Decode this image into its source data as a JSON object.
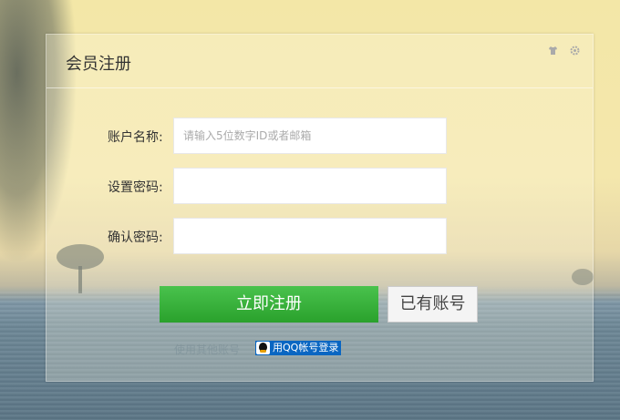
{
  "panel": {
    "title": "会员注册",
    "header_icons": [
      "shirt-icon",
      "gear-icon"
    ]
  },
  "form": {
    "account": {
      "label": "账户名称:",
      "placeholder": "请输入5位数字ID或者邮箱",
      "value": ""
    },
    "password": {
      "label": "设置密码:",
      "value": ""
    },
    "confirm": {
      "label": "确认密码:",
      "value": ""
    }
  },
  "buttons": {
    "register": "立即注册",
    "have_account": "已有账号"
  },
  "other_login": {
    "text": "使用其他账号",
    "qq_label": "用QQ帐号登录"
  },
  "colors": {
    "primary_green": "#2aa12c",
    "qq_blue": "#0a66c2"
  }
}
